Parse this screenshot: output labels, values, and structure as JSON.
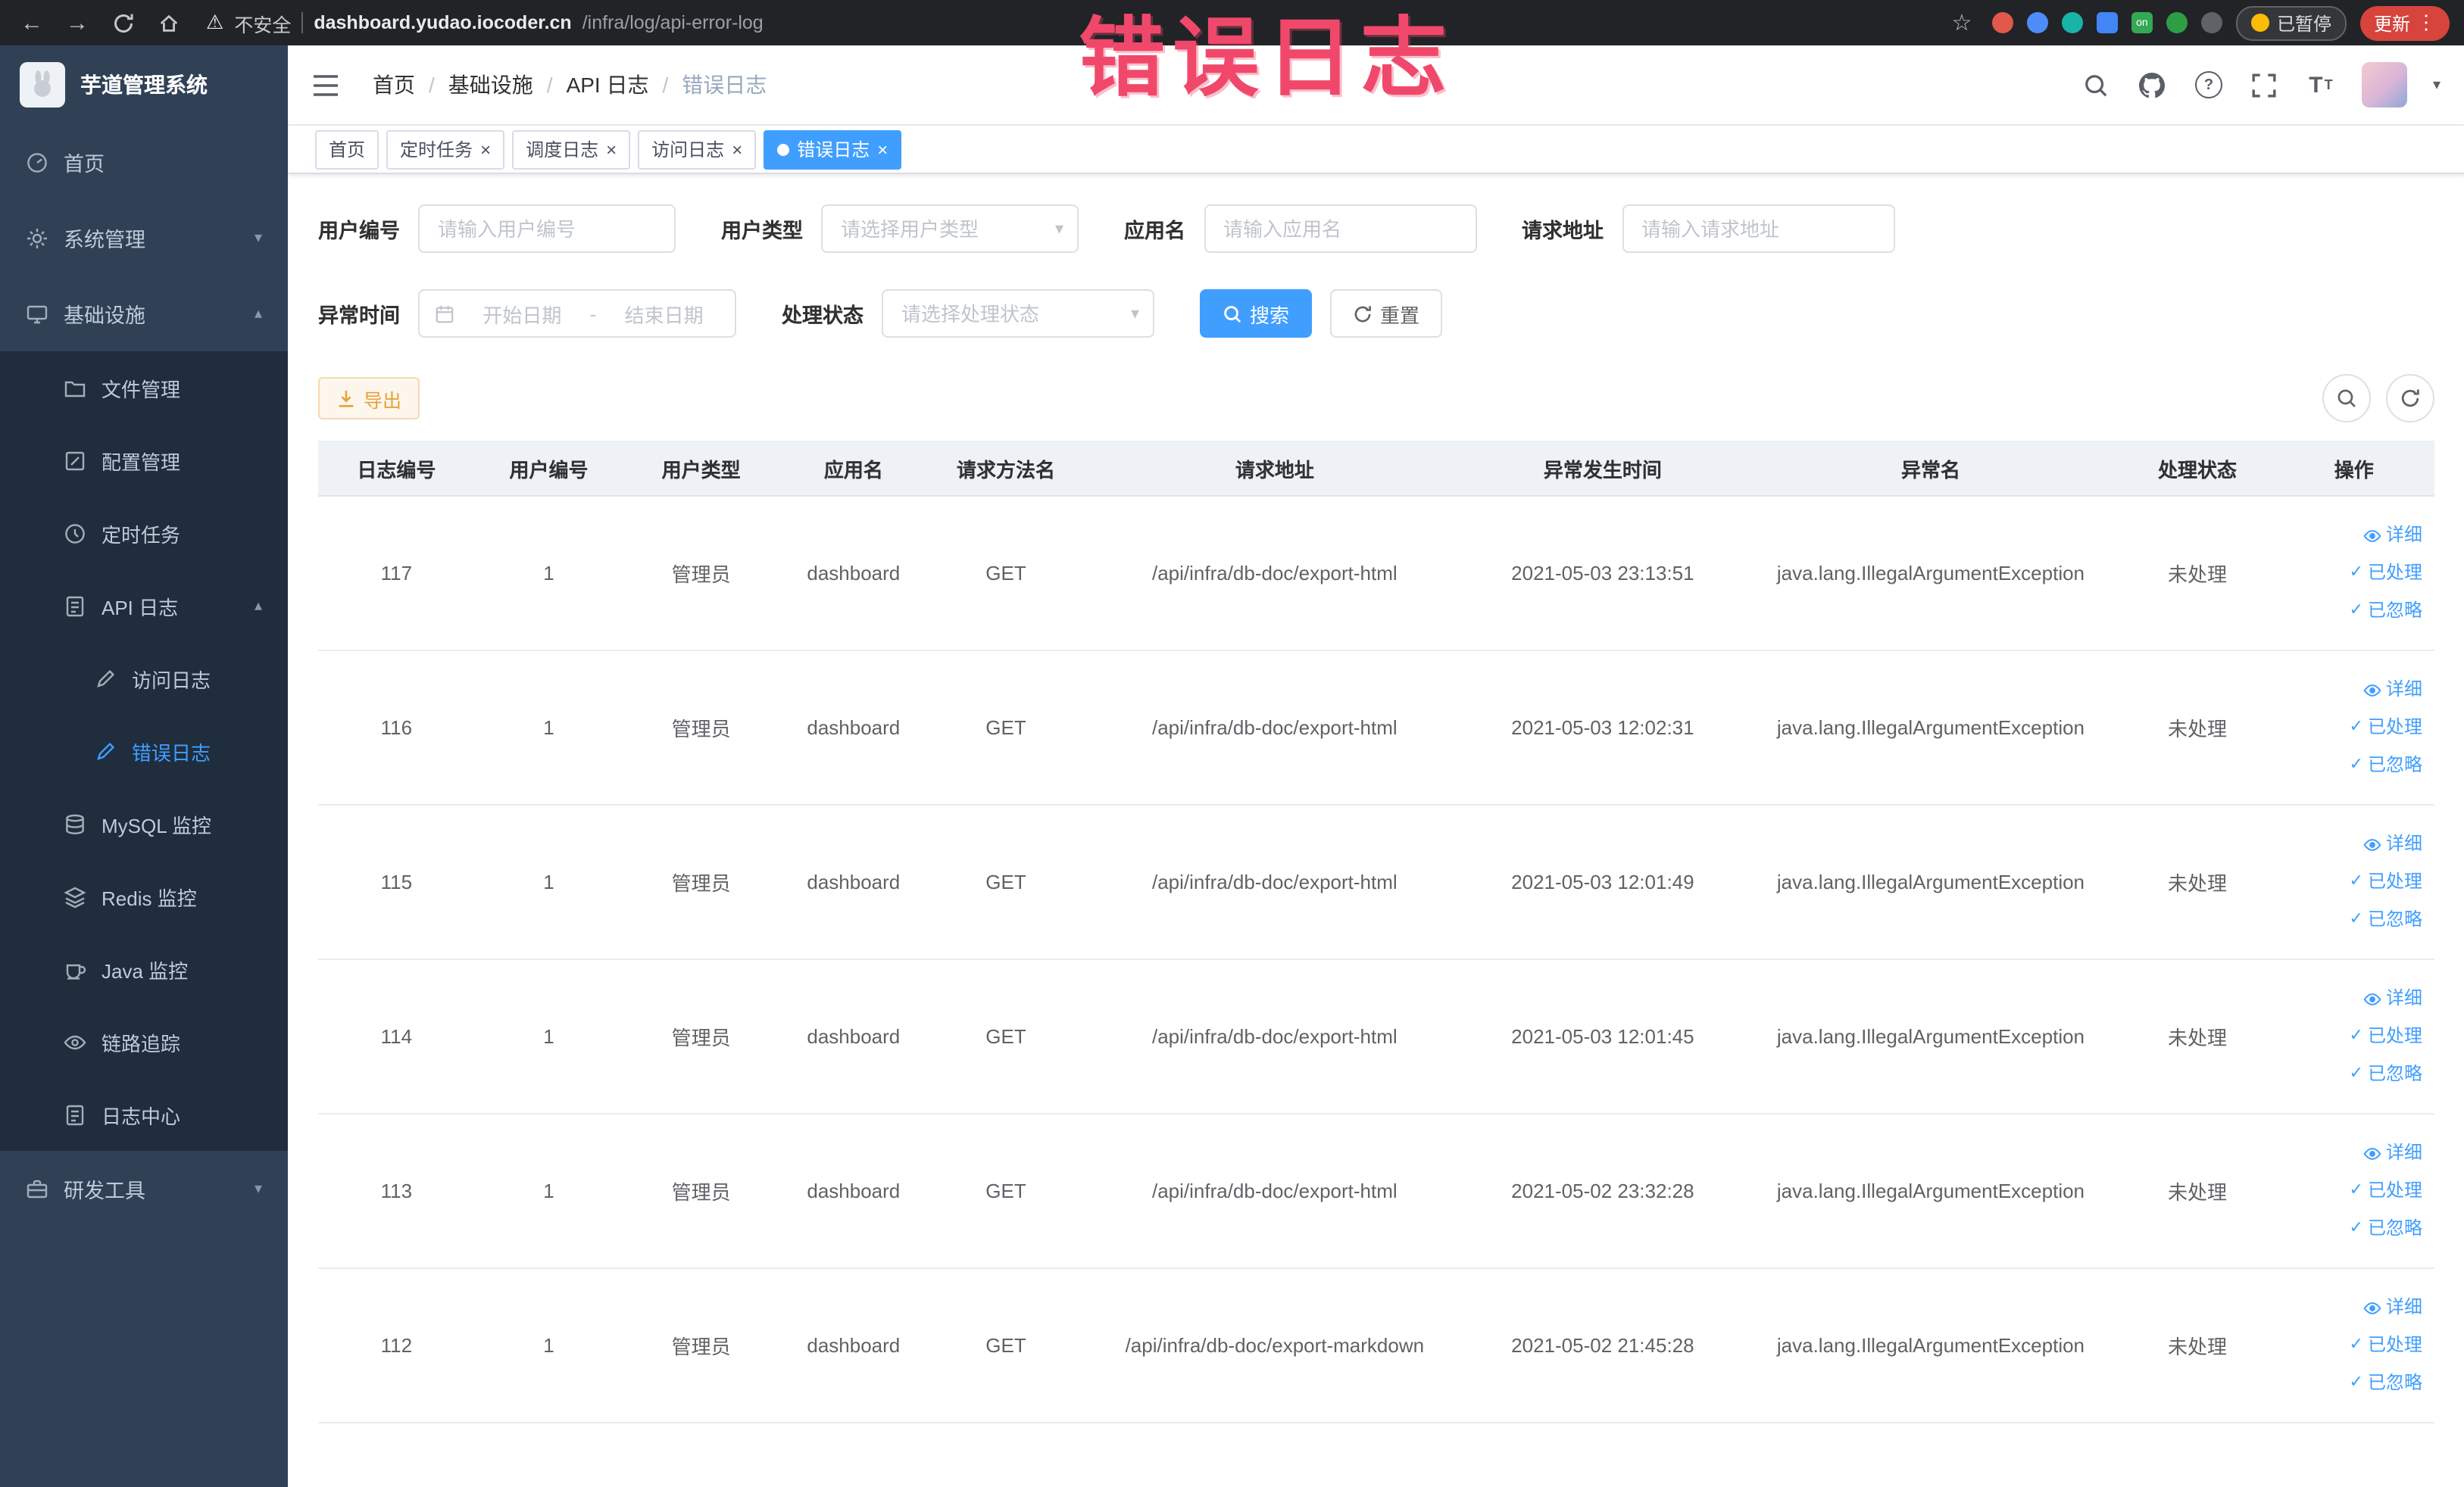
{
  "theme": {
    "primary": "#409EFF",
    "warning": "#E6A23C",
    "sidebar_bg": "#304156",
    "submenu_bg": "#1F2D3D",
    "annotation_red": "#F0486B"
  },
  "annotation": {
    "text": "错误日志"
  },
  "browser": {
    "security_label": "不安全",
    "url_host": "dashboard.yudao.iocoder.cn",
    "url_path": "/infra/log/api-error-log",
    "extension_on_label": "on",
    "paused_badge": "已暂停",
    "update_button": "更新"
  },
  "sidebar": {
    "app_title": "芋道管理系统",
    "items": {
      "home": "首页",
      "system": "系统管理",
      "infra": "基础设施",
      "file": "文件管理",
      "config": "配置管理",
      "job": "定时任务",
      "api_log": "API 日志",
      "access_log": "访问日志",
      "error_log": "错误日志",
      "mysql": "MySQL 监控",
      "redis": "Redis 监控",
      "java": "Java 监控",
      "trace": "链路追踪",
      "log_center": "日志中心",
      "dev_tools": "研发工具"
    }
  },
  "breadcrumb": [
    "首页",
    "基础设施",
    "API 日志",
    "错误日志"
  ],
  "tabs": [
    {
      "label": "首页"
    },
    {
      "label": "定时任务"
    },
    {
      "label": "调度日志"
    },
    {
      "label": "访问日志"
    },
    {
      "label": "错误日志"
    }
  ],
  "filters": {
    "user_id": {
      "label": "用户编号",
      "placeholder": "请输入用户编号",
      "value": ""
    },
    "user_type": {
      "label": "用户类型",
      "placeholder": "请选择用户类型",
      "value": ""
    },
    "app_name": {
      "label": "应用名",
      "placeholder": "请输入应用名",
      "value": ""
    },
    "request_url": {
      "label": "请求地址",
      "placeholder": "请输入请求地址",
      "value": ""
    },
    "exception_time": {
      "label": "异常时间",
      "start_placeholder": "开始日期",
      "separator": "-",
      "end_placeholder": "结束日期"
    },
    "process_status": {
      "label": "处理状态",
      "placeholder": "请选择处理状态",
      "value": ""
    },
    "search_button": "搜索",
    "reset_button": "重置"
  },
  "toolbar": {
    "export_button": "导出"
  },
  "table": {
    "columns": [
      "日志编号",
      "用户编号",
      "用户类型",
      "应用名",
      "请求方法名",
      "请求地址",
      "异常发生时间",
      "异常名",
      "处理状态",
      "操作"
    ],
    "row_actions": {
      "detail": "详细",
      "processed": "已处理",
      "ignored": "已忽略"
    },
    "rows": [
      {
        "log_id": "117",
        "user_id": "1",
        "user_type": "管理员",
        "app_name": "dashboard",
        "method": "GET",
        "request_url": "/api/infra/db-doc/export-html",
        "exception_time": "2021-05-03 23:13:51",
        "exception_name": "java.lang.IllegalArgumentException",
        "process_status": "未处理"
      },
      {
        "log_id": "116",
        "user_id": "1",
        "user_type": "管理员",
        "app_name": "dashboard",
        "method": "GET",
        "request_url": "/api/infra/db-doc/export-html",
        "exception_time": "2021-05-03 12:02:31",
        "exception_name": "java.lang.IllegalArgumentException",
        "process_status": "未处理"
      },
      {
        "log_id": "115",
        "user_id": "1",
        "user_type": "管理员",
        "app_name": "dashboard",
        "method": "GET",
        "request_url": "/api/infra/db-doc/export-html",
        "exception_time": "2021-05-03 12:01:49",
        "exception_name": "java.lang.IllegalArgumentException",
        "process_status": "未处理"
      },
      {
        "log_id": "114",
        "user_id": "1",
        "user_type": "管理员",
        "app_name": "dashboard",
        "method": "GET",
        "request_url": "/api/infra/db-doc/export-html",
        "exception_time": "2021-05-03 12:01:45",
        "exception_name": "java.lang.IllegalArgumentException",
        "process_status": "未处理"
      },
      {
        "log_id": "113",
        "user_id": "1",
        "user_type": "管理员",
        "app_name": "dashboard",
        "method": "GET",
        "request_url": "/api/infra/db-doc/export-html",
        "exception_time": "2021-05-02 23:32:28",
        "exception_name": "java.lang.IllegalArgumentException",
        "process_status": "未处理"
      },
      {
        "log_id": "112",
        "user_id": "1",
        "user_type": "管理员",
        "app_name": "dashboard",
        "method": "GET",
        "request_url": "/api/infra/db-doc/export-markdown",
        "exception_time": "2021-05-02 21:45:28",
        "exception_name": "java.lang.IllegalArgumentException",
        "process_status": "未处理"
      }
    ]
  }
}
